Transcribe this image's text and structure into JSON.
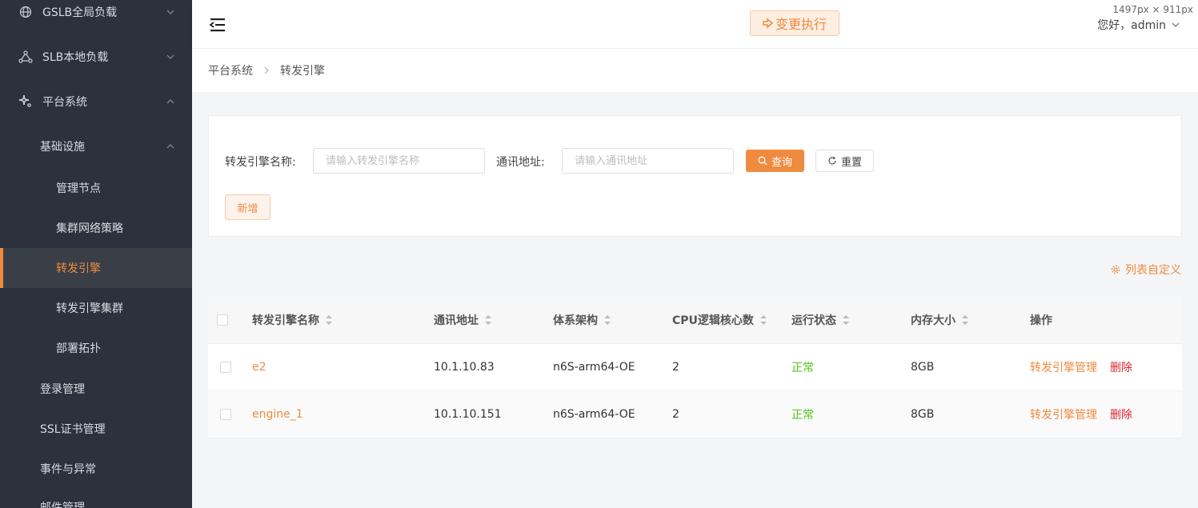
{
  "sidebar": {
    "items": [
      {
        "label": "GSLB全局负载",
        "icon": "globe-icon",
        "level": 1,
        "expanded": false
      },
      {
        "label": "SLB本地负载",
        "icon": "network-nodes-icon",
        "level": 1,
        "expanded": false
      },
      {
        "label": "平台系统",
        "icon": "gears-icon",
        "level": 1,
        "expanded": true
      },
      {
        "label": "基础设施",
        "level": 2,
        "expanded": true
      },
      {
        "label": "管理节点",
        "level": 3
      },
      {
        "label": "集群网络策略",
        "level": 3
      },
      {
        "label": "转发引擎",
        "level": 3,
        "active": true
      },
      {
        "label": "转发引擎集群",
        "level": 3
      },
      {
        "label": "部署拓扑",
        "level": 3
      },
      {
        "label": "登录管理",
        "level": 2
      },
      {
        "label": "SSL证书管理",
        "level": 2
      },
      {
        "label": "事件与异常",
        "level": 2
      },
      {
        "label": "邮件管理",
        "level": 2
      }
    ]
  },
  "header": {
    "exec_label": "变更执行",
    "size_badge": "1497px × 911px",
    "greeting": "您好，admin"
  },
  "breadcrumb": [
    "平台系统",
    "转发引擎"
  ],
  "search": {
    "name_label": "转发引擎名称:",
    "name_placeholder": "请输入转发引擎名称",
    "addr_label": "通讯地址:",
    "addr_placeholder": "请输入通讯地址",
    "query_label": "查询",
    "reset_label": "重置",
    "add_label": "新增"
  },
  "customize_label": "列表自定义",
  "table": {
    "columns": [
      "转发引擎名称",
      "通讯地址",
      "体系架构",
      "CPU逻辑核心数",
      "运行状态",
      "内存大小",
      "操作"
    ],
    "rows": [
      {
        "name": "e2",
        "addr": "10.1.10.83",
        "arch": "n6S-arm64-OE",
        "cpu": "2",
        "status": "正常",
        "mem": "8GB",
        "manage": "转发引擎管理",
        "delete": "删除"
      },
      {
        "name": "engine_1",
        "addr": "10.1.10.151",
        "arch": "n6S-arm64-OE",
        "cpu": "2",
        "status": "正常",
        "mem": "8GB",
        "manage": "转发引擎管理",
        "delete": "删除"
      }
    ]
  },
  "colors": {
    "accent": "#ef8b3f",
    "sidebar_bg": "#2b323e",
    "success": "#52c41a",
    "danger": "#e0262f"
  }
}
